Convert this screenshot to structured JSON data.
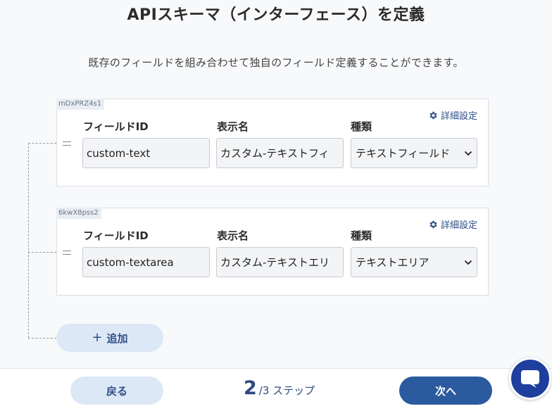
{
  "page": {
    "title": "APIスキーマ（インターフェース）を定義",
    "description": "既存のフィールドを組み合わせて独自のフィールド定義することができます。"
  },
  "fields": [
    {
      "tag": "mDxPRZ4s1",
      "detail_label": "詳細設定",
      "id_label": "フィールドID",
      "id_value": "custom-text",
      "name_label": "表示名",
      "name_value": "カスタム-テキストフィ",
      "type_label": "種類",
      "type_value": "テキストフィールド"
    },
    {
      "tag": "6kwX8pss2",
      "detail_label": "詳細設定",
      "id_label": "フィールドID",
      "id_value": "custom-textarea",
      "name_label": "表示名",
      "name_value": "カスタム-テキストエリ",
      "type_label": "種類",
      "type_value": "テキストエリア"
    }
  ],
  "add_button": {
    "icon": "+",
    "label": "追加"
  },
  "footer": {
    "back_label": "戻る",
    "step_current": "2",
    "step_total": "/3 ステップ",
    "next_label": "次へ"
  },
  "colors": {
    "accent": "#2c5a9e",
    "accent_light": "#dde8f6",
    "link": "#2f4f86",
    "chat": "#1e3f9e"
  },
  "icons": {
    "detail": "gear-icon",
    "select": "chevron-down-icon",
    "chat": "chat-bubble-icon",
    "drag": "drag-handle-icon"
  }
}
